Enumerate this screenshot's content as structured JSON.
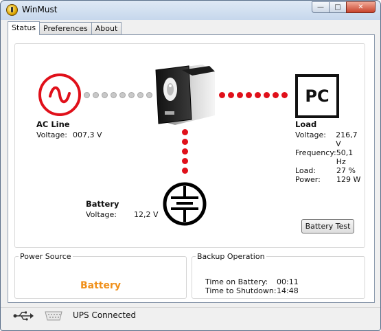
{
  "window": {
    "title": "WinMust"
  },
  "tabs": [
    {
      "label": "Status",
      "active": true
    },
    {
      "label": "Preferences",
      "active": false
    },
    {
      "label": "About",
      "active": false
    }
  ],
  "ac_line": {
    "heading": "AC Line",
    "voltage_label": "Voltage:",
    "voltage_value": "007,3 V"
  },
  "ups_icon_name": "ups-device-icon",
  "load": {
    "icon_text": "PC",
    "heading": "Load",
    "rows": [
      {
        "label": "Voltage:",
        "value": "216,7 V"
      },
      {
        "label": "Frequency:",
        "value": "50,1 Hz"
      },
      {
        "label": "Load:",
        "value": "27 %"
      },
      {
        "label": "Power:",
        "value": "129 W"
      }
    ]
  },
  "battery": {
    "heading": "Battery",
    "voltage_label": "Voltage:",
    "voltage_value": "12,2 V"
  },
  "battery_test_button": "Battery Test",
  "power_source": {
    "legend": "Power Source",
    "value": "Battery",
    "value_color": "#f0901a"
  },
  "backup_operation": {
    "legend": "Backup Operation",
    "rows": [
      {
        "label": "Time on Battery:",
        "value": "00:11"
      },
      {
        "label": "Time to Shutdown:",
        "value": "14:48"
      }
    ]
  },
  "status_bar": {
    "text": "UPS Connected"
  },
  "colors": {
    "ac_red": "#e0101a",
    "link_grey": "#c8c8c8",
    "link_red": "#e0101a"
  }
}
